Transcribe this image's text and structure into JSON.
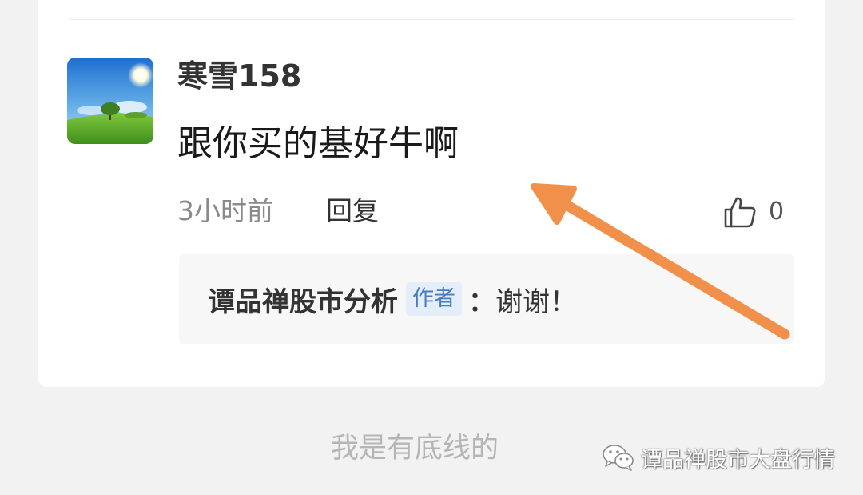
{
  "comment": {
    "username": "寒雪158",
    "text": "跟你买的基好牛啊",
    "timestamp": "3小时前",
    "reply_label": "回复",
    "like_count": "0",
    "avatar_icon": "landscape-avatar-icon"
  },
  "author_reply": {
    "author": "谭品禅股市分析",
    "badge": "作者",
    "colon": "：",
    "text": "谢谢！"
  },
  "footer": {
    "text": "我是有底线的"
  },
  "watermark": {
    "icon": "wechat-icon",
    "text": "谭品禅股市大盘行情"
  },
  "colors": {
    "arrow": "#f0904a",
    "badge_bg": "#e4eefb",
    "badge_text": "#4a7cc0",
    "background": "#f2f2f2"
  }
}
